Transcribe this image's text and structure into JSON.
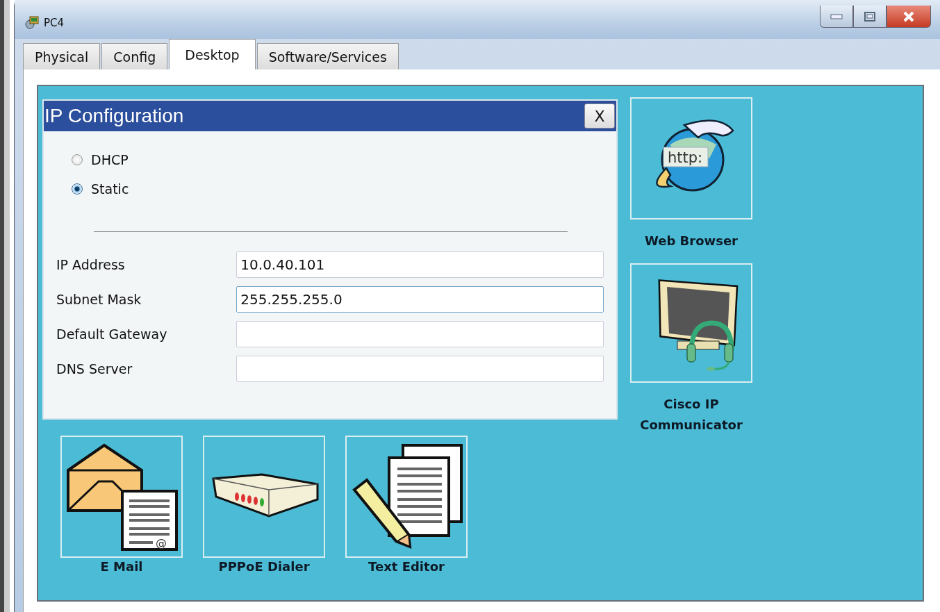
{
  "window": {
    "title": "PC4"
  },
  "tabs": [
    {
      "label": "Physical",
      "selected": false
    },
    {
      "label": "Config",
      "selected": false
    },
    {
      "label": "Desktop",
      "selected": true
    },
    {
      "label": "Software/Services",
      "selected": false
    }
  ],
  "desktop_apps": [
    {
      "kind": "web-browser",
      "label": "Web Browser",
      "icon_text": "http:"
    },
    {
      "kind": "ip-communicator",
      "label": "Cisco IP Communicator"
    },
    {
      "kind": "email",
      "label": "E Mail",
      "icon_text": "@"
    },
    {
      "kind": "pppoe-dialer",
      "label": "PPPoE Dialer"
    },
    {
      "kind": "text-editor",
      "label": "Text Editor"
    }
  ],
  "dialog": {
    "title": "IP Configuration",
    "close": "X",
    "modes": [
      {
        "label": "DHCP",
        "selected": false
      },
      {
        "label": "Static",
        "selected": true
      }
    ],
    "fields": [
      {
        "label": "IP Address",
        "value": "10.0.40.101",
        "focused": false
      },
      {
        "label": "Subnet Mask",
        "value": "255.255.255.0",
        "focused": true
      },
      {
        "label": "Default Gateway",
        "focused": false
      },
      {
        "label": "DNS Server",
        "focused": false
      }
    ]
  }
}
